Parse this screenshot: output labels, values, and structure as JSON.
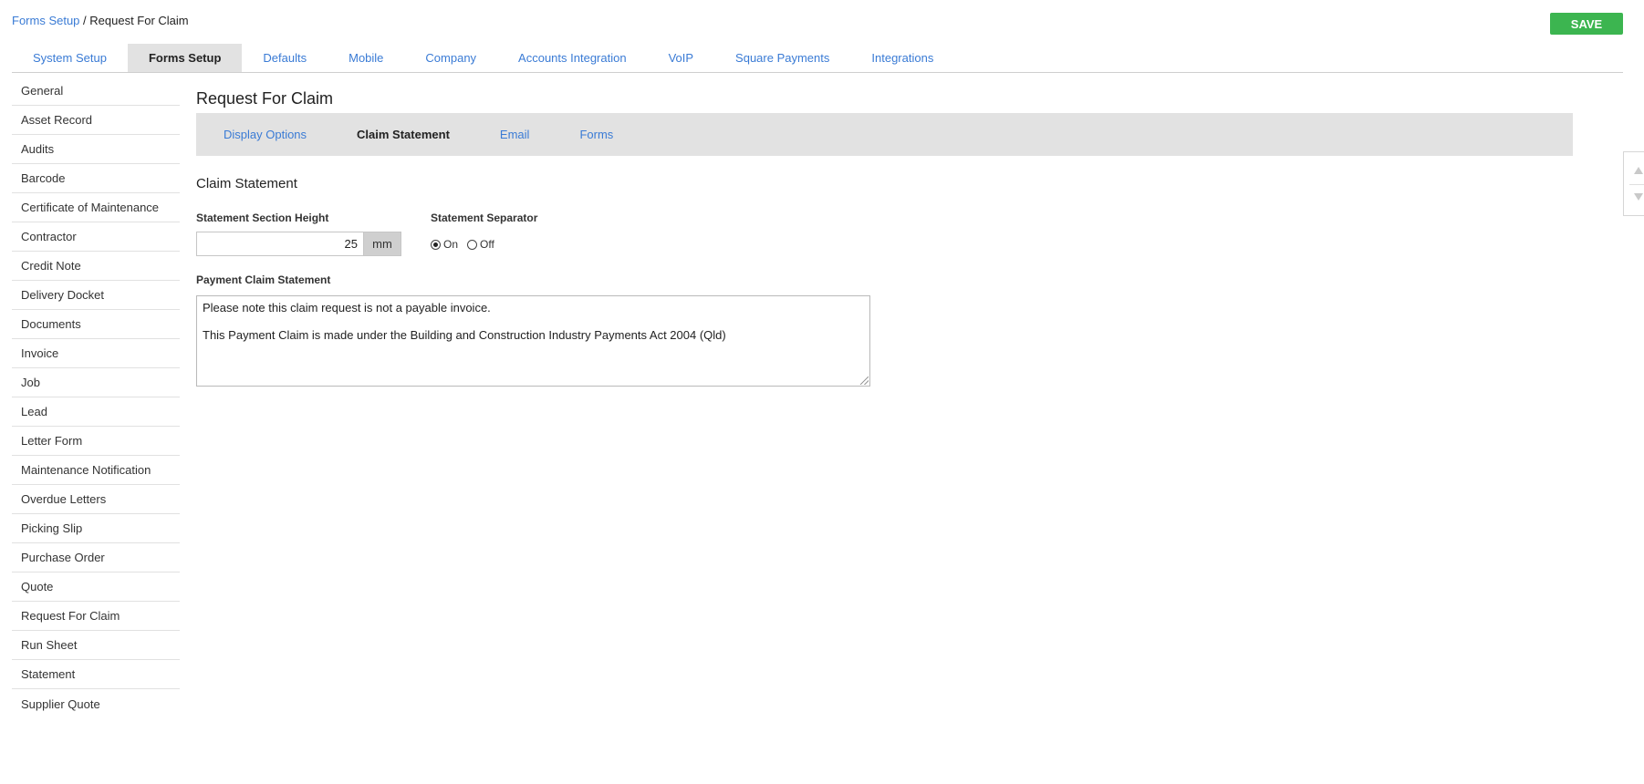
{
  "breadcrumb": {
    "link": "Forms Setup",
    "separator": " / ",
    "current": "Request For Claim"
  },
  "save_label": "SAVE",
  "main_tabs": [
    {
      "label": "System Setup",
      "active": false
    },
    {
      "label": "Forms Setup",
      "active": true
    },
    {
      "label": "Defaults",
      "active": false
    },
    {
      "label": "Mobile",
      "active": false
    },
    {
      "label": "Company",
      "active": false
    },
    {
      "label": "Accounts Integration",
      "active": false
    },
    {
      "label": "VoIP",
      "active": false
    },
    {
      "label": "Square Payments",
      "active": false
    },
    {
      "label": "Integrations",
      "active": false
    }
  ],
  "sidebar": {
    "items": [
      "General",
      "Asset Record",
      "Audits",
      "Barcode",
      "Certificate of Maintenance",
      "Contractor",
      "Credit Note",
      "Delivery Docket",
      "Documents",
      "Invoice",
      "Job",
      "Lead",
      "Letter Form",
      "Maintenance Notification",
      "Overdue Letters",
      "Picking Slip",
      "Purchase Order",
      "Quote",
      "Request For Claim",
      "Run Sheet",
      "Statement",
      "Supplier Quote"
    ]
  },
  "page_title": "Request For Claim",
  "sub_tabs": [
    {
      "label": "Display Options",
      "active": false
    },
    {
      "label": "Claim Statement",
      "active": true
    },
    {
      "label": "Email",
      "active": false
    },
    {
      "label": "Forms",
      "active": false
    }
  ],
  "section_title": "Claim Statement",
  "statement_height": {
    "label": "Statement Section Height",
    "value": "25",
    "unit": "mm"
  },
  "separator": {
    "label": "Statement Separator",
    "on_label": "On",
    "off_label": "Off",
    "selected": "On"
  },
  "payment_claim": {
    "label": "Payment Claim Statement",
    "lines": [
      "Please note this claim request is not a payable invoice.",
      "This Payment Claim is made under the Building and Construction Industry Payments Act 2004 (Qld)"
    ]
  },
  "colors": {
    "accent_link": "#3a7bd5",
    "save_button": "#3cb550",
    "tab_active_bg": "#e2e2e2"
  },
  "icons": {
    "scroll_up": "triangle-up-icon",
    "scroll_down": "triangle-down-icon"
  }
}
